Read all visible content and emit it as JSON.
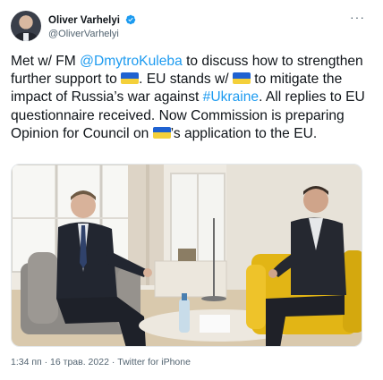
{
  "author": {
    "display_name": "Oliver Varhelyi",
    "handle": "@OliverVarhelyi"
  },
  "more_label": "···",
  "tweet": {
    "line1_a": "Met w/ FM ",
    "mention": "@DmytroKuleba",
    "line1_b": " to discuss how to strengthen further support to ",
    "part2": ". EU stands w/ ",
    "part3": " to mitigate the impact of Russia’s war against ",
    "hashtag": "#Ukraine",
    "part4": ". All replies to EU questionnaire received. Now Commission is preparing Opinion for Council on ",
    "part5": "’s application to the EU."
  },
  "footer": {
    "timestamp": "1:34 пп · 16 трав. 2022 · Twitter for iPhone"
  },
  "colors": {
    "link": "#1d9bf0",
    "verified": "#1d9bf0",
    "flag_blue": "#1f62d1",
    "flag_yellow": "#f4d03a"
  }
}
